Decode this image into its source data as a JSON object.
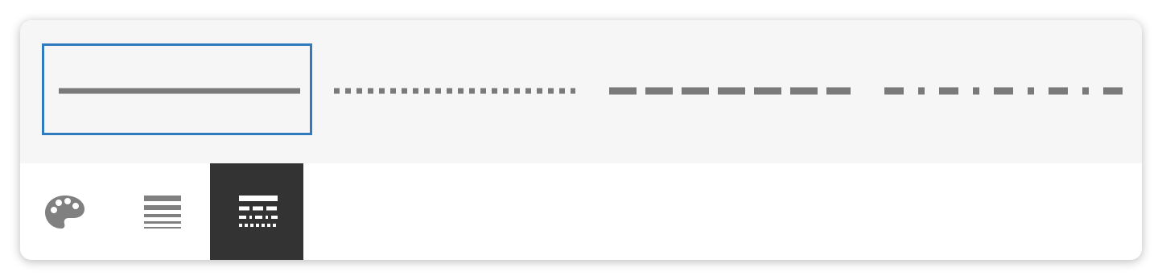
{
  "line_styles": {
    "selected": "solid",
    "options": [
      "solid",
      "dotted",
      "dashed",
      "dash-dot"
    ]
  },
  "toolbar": {
    "tools": [
      "color-palette",
      "line-weight",
      "line-style"
    ],
    "active": "line-style"
  },
  "colors": {
    "selection_border": "#2f7bbd",
    "line": "#7a7a7a",
    "icon": "#808080",
    "active_tool_bg": "#333333",
    "active_icon": "#ffffff"
  }
}
